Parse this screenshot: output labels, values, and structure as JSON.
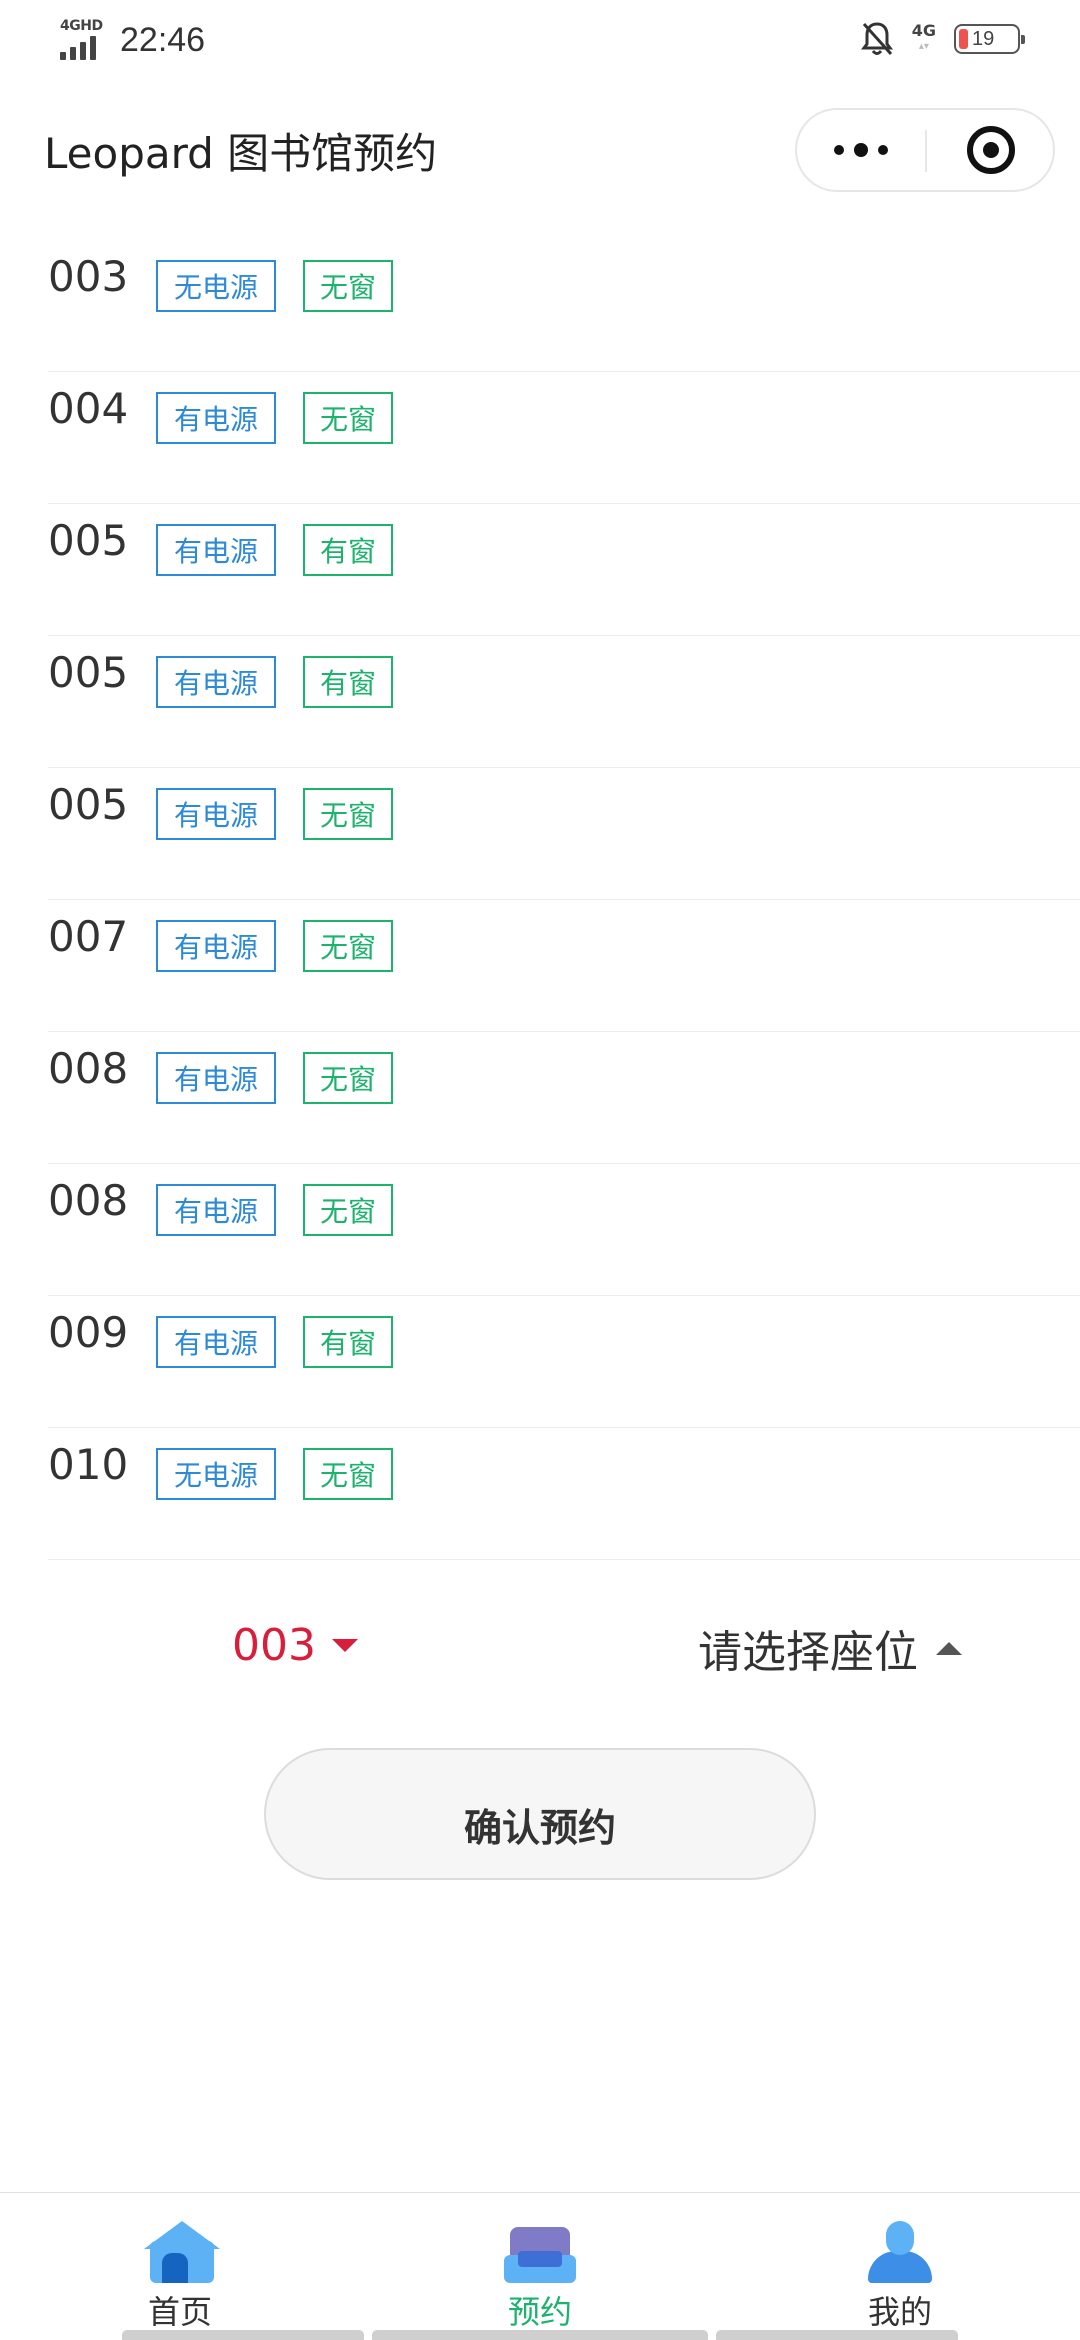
{
  "status_bar": {
    "network_label": "4GHD",
    "time": "22:46",
    "signal_label": "4G",
    "battery": "19"
  },
  "navbar": {
    "title": "Leopard 图书馆预约"
  },
  "seats": [
    {
      "number": "003",
      "power": "无电源",
      "window": "无窗"
    },
    {
      "number": "004",
      "power": "有电源",
      "window": "无窗"
    },
    {
      "number": "005",
      "power": "有电源",
      "window": "有窗"
    },
    {
      "number": "005",
      "power": "有电源",
      "window": "有窗"
    },
    {
      "number": "005",
      "power": "有电源",
      "window": "无窗"
    },
    {
      "number": "007",
      "power": "有电源",
      "window": "无窗"
    },
    {
      "number": "008",
      "power": "有电源",
      "window": "无窗"
    },
    {
      "number": "008",
      "power": "有电源",
      "window": "无窗"
    },
    {
      "number": "009",
      "power": "有电源",
      "window": "有窗"
    },
    {
      "number": "010",
      "power": "无电源",
      "window": "无窗"
    }
  ],
  "picker": {
    "selected_seat": "003",
    "seat_prompt": "请选择座位"
  },
  "confirm_button": "确认预约",
  "tabbar": {
    "items": [
      {
        "label": "首页",
        "icon": "home-icon"
      },
      {
        "label": "预约",
        "icon": "sofa-icon",
        "active": true
      },
      {
        "label": "我的",
        "icon": "user-icon"
      }
    ],
    "active_color": "#1db26d"
  },
  "colors": {
    "power_tag": "#2f8ad6",
    "window_tag": "#1db26d",
    "selected_seat": "#d81e3a"
  }
}
